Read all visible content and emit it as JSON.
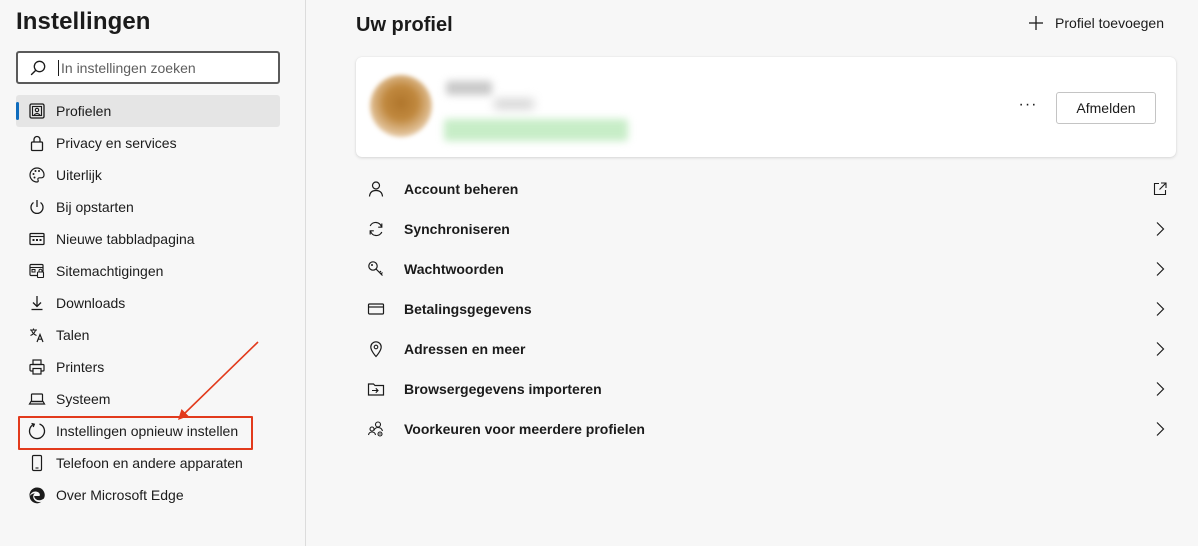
{
  "sidebar": {
    "title": "Instellingen",
    "search_placeholder": "In instellingen zoeken",
    "items": [
      {
        "label": "Profielen",
        "icon": "profile-card-icon"
      },
      {
        "label": "Privacy en services",
        "icon": "lock-icon"
      },
      {
        "label": "Uiterlijk",
        "icon": "palette-icon"
      },
      {
        "label": "Bij opstarten",
        "icon": "power-icon"
      },
      {
        "label": "Nieuwe tabbladpagina",
        "icon": "new-tab-page-icon"
      },
      {
        "label": "Sitemachtigingen",
        "icon": "site-permissions-icon"
      },
      {
        "label": "Downloads",
        "icon": "download-icon"
      },
      {
        "label": "Talen",
        "icon": "languages-icon"
      },
      {
        "label": "Printers",
        "icon": "printer-icon"
      },
      {
        "label": "Systeem",
        "icon": "laptop-icon"
      },
      {
        "label": "Instellingen opnieuw instellen",
        "icon": "reset-icon"
      },
      {
        "label": "Telefoon en andere apparaten",
        "icon": "phone-icon"
      },
      {
        "label": "Over Microsoft Edge",
        "icon": "edge-logo-icon"
      }
    ],
    "active_index": 0,
    "highlighted_index": 10
  },
  "main": {
    "title": "Uw profiel",
    "add_profile_label": "Profiel toevoegen",
    "profile_card": {
      "more_label": "···",
      "signout_label": "Afmelden"
    },
    "rows": [
      {
        "label": "Account beheren",
        "icon": "person-icon",
        "trailing": "external-link-icon"
      },
      {
        "label": "Synchroniseren",
        "icon": "sync-icon",
        "trailing": "chevron-right-icon"
      },
      {
        "label": "Wachtwoorden",
        "icon": "key-icon",
        "trailing": "chevron-right-icon"
      },
      {
        "label": "Betalingsgegevens",
        "icon": "credit-card-icon",
        "trailing": "chevron-right-icon"
      },
      {
        "label": "Adressen en meer",
        "icon": "location-pin-icon",
        "trailing": "chevron-right-icon"
      },
      {
        "label": "Browsergegevens importeren",
        "icon": "import-folder-icon",
        "trailing": "chevron-right-icon"
      },
      {
        "label": "Voorkeuren voor meerdere profielen",
        "icon": "multi-profile-icon",
        "trailing": "chevron-right-icon"
      }
    ]
  },
  "colors": {
    "accent": "#0f6cbd",
    "annotation_red": "#e23a1c",
    "background": "#f7f7f7"
  }
}
